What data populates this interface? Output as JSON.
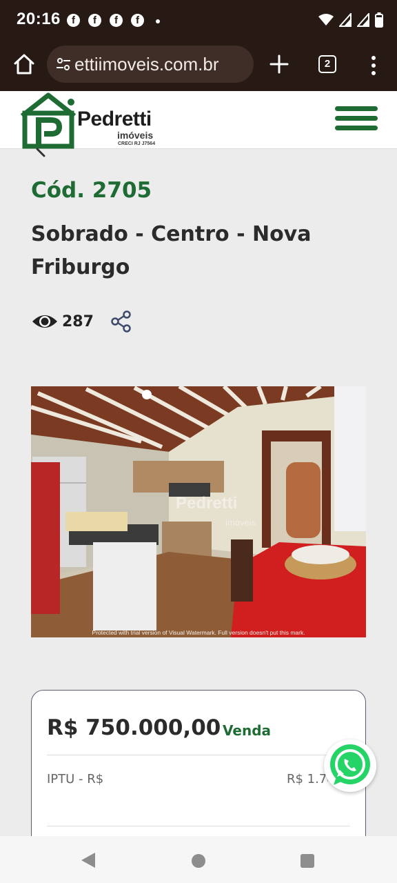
{
  "status_bar": {
    "time": "20:16",
    "notification_icons": [
      "facebook-icon",
      "facebook-icon",
      "facebook-icon",
      "facebook-icon"
    ],
    "system_icons": [
      "wifi-icon",
      "signal-icon",
      "signal-icon",
      "battery-icon"
    ]
  },
  "browser": {
    "url": "ettiimoveis.com.br",
    "tab_count": "2"
  },
  "header": {
    "brand_name": "Pedretti",
    "brand_sub": "imóveis",
    "creci": "CRECI RJ J7564",
    "brand_color": "#1e6b33"
  },
  "listing": {
    "code": "Cód. 2705",
    "title": "Sobrado - Centro - Nova Friburgo",
    "views": "287"
  },
  "photo": {
    "watermark_text": "Protected with trial version of Visual Watermark. Full version doesn't put this mark.",
    "watermark_logo": "Pedretti",
    "watermark_sub": "imóveis"
  },
  "price_card": {
    "price": "R$ 750.000,00",
    "transaction": "Venda",
    "iptu_label": "IPTU - R$",
    "iptu_value": "R$ 1.78"
  },
  "colors": {
    "status_bg": "#271914",
    "accent_green": "#1e6b33",
    "whatsapp_green": "#25d366"
  }
}
